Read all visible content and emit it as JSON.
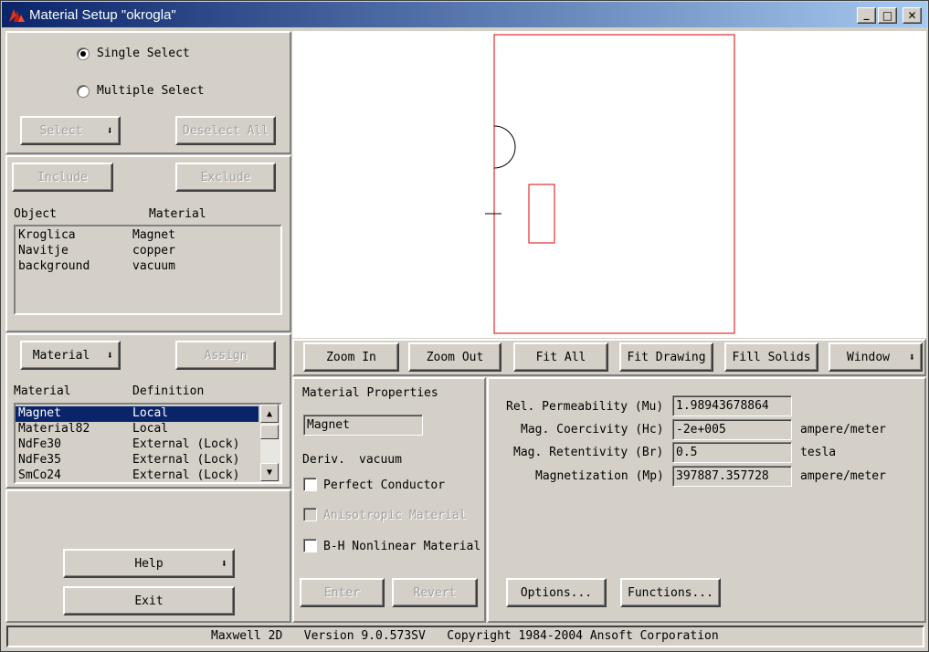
{
  "window": {
    "title": "Material Setup \"okrogla\"",
    "controls": {
      "minimize": "_",
      "maximize": "□",
      "close": "✕"
    }
  },
  "selection": {
    "single_label": "Single Select",
    "multiple_label": "Multiple Select",
    "selected_mode": "single",
    "select_button": "Select",
    "deselect_all_button": "Deselect All"
  },
  "objects": {
    "include_button": "Include",
    "exclude_button": "Exclude",
    "col_object": "Object",
    "col_material": "Material",
    "rows": [
      {
        "object": "Kroglica",
        "material": "Magnet"
      },
      {
        "object": "Navitje",
        "material": "copper"
      },
      {
        "object": "background",
        "material": "vacuum"
      }
    ]
  },
  "materials": {
    "material_button": "Material",
    "assign_button": "Assign",
    "col_material": "Material",
    "col_definition": "Definition",
    "rows": [
      {
        "material": "Magnet",
        "definition": "Local",
        "selected": true
      },
      {
        "material": "Material82",
        "definition": "Local",
        "selected": false
      },
      {
        "material": "NdFe30",
        "definition": "External (Lock)",
        "selected": false
      },
      {
        "material": "NdFe35",
        "definition": "External (Lock)",
        "selected": false
      },
      {
        "material": "SmCo24",
        "definition": "External (Lock)",
        "selected": false
      }
    ]
  },
  "left_bottom": {
    "help_button": "Help",
    "exit_button": "Exit"
  },
  "view_toolbar": {
    "zoom_in": "Zoom In",
    "zoom_out": "Zoom Out",
    "fit_all": "Fit All",
    "fit_drawing": "Fit Drawing",
    "fill_solids": "Fill Solids",
    "window": "Window"
  },
  "properties": {
    "heading": "Material Properties",
    "material_name": "Magnet",
    "deriv_label": "Deriv.",
    "deriv_value": "vacuum",
    "perfect_conductor": "Perfect Conductor",
    "anisotropic": "Anisotropic Material",
    "bh_nonlinear": "B-H Nonlinear Material",
    "enter_button": "Enter",
    "revert_button": "Revert"
  },
  "values": {
    "rows": [
      {
        "label": "Rel. Permeability (Mu)",
        "value": "1.98943678864",
        "unit": ""
      },
      {
        "label": "Mag. Coercivity (Hc)",
        "value": "-2e+005",
        "unit": "ampere/meter"
      },
      {
        "label": "Mag. Retentivity (Br)",
        "value": "0.5",
        "unit": "tesla"
      },
      {
        "label": "Magnetization (Mp)",
        "value": "397887.357728",
        "unit": "ampere/meter"
      }
    ],
    "options_button": "Options...",
    "functions_button": "Functions..."
  },
  "status_bar": {
    "text": "Maxwell 2D   Version 9.0.573SV   Copyright 1984-2004 Ansoft Corporation"
  },
  "colors": {
    "selection": "#0a246a",
    "drawing_outline": "#e00000",
    "drawing_black": "#000000"
  },
  "icons": {
    "app": "ansoft-logo-icon",
    "dropdown": "dropdown-arrow-icon"
  }
}
